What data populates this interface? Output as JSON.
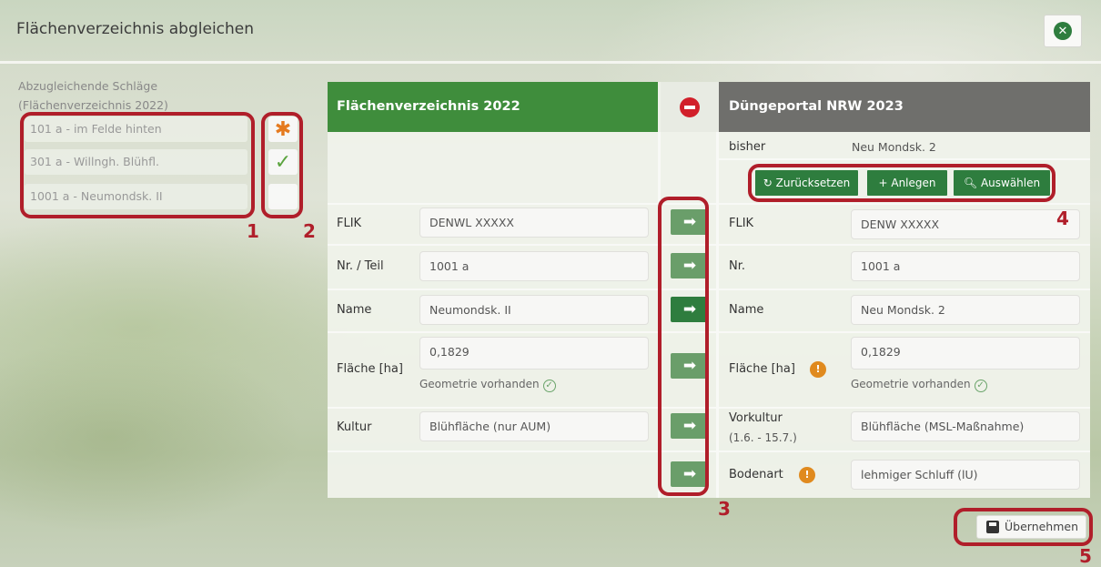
{
  "dialog": {
    "title": "Flächenverzeichnis abgleichen",
    "close_icon": "close-circle-icon"
  },
  "left_list": {
    "label_line1": "Abzugleichende Schläge",
    "label_line2": "(Flächenverzeichnis 2022)",
    "items": [
      {
        "label": "101 a - im Felde hinten",
        "status_icon": "asterisk-icon",
        "status_glyph": "✱"
      },
      {
        "label": "301 a - Willngh. Blühfl.",
        "status_icon": "check-icon",
        "status_glyph": "✓"
      },
      {
        "label": "1001 a - Neumondsk. II",
        "status_icon": "empty-icon",
        "status_glyph": ""
      }
    ]
  },
  "annotations": {
    "n1": "1",
    "n2": "2",
    "n3": "3",
    "n4": "4",
    "n5": "5"
  },
  "left_column": {
    "header": "Flächenverzeichnis 2022",
    "rows": {
      "flik_label": "FLIK",
      "flik_value": "DENWL  XXXXX",
      "nr_label": "Nr. / Teil",
      "nr_value": "1001 a",
      "name_label": "Name",
      "name_value": "Neumondsk. II",
      "flaeche_label": "Fläche [ha]",
      "flaeche_value": "0,1829",
      "geometry": "Geometrie vorhanden",
      "kultur_label": "Kultur",
      "kultur_value": "Blühfläche (nur AUM)"
    }
  },
  "right_column": {
    "header": "Düngeportal NRW 2023",
    "bisher_label": "bisher",
    "bisher_value": "Neu Mondsk. 2",
    "buttons": {
      "reset": "Zurücksetzen",
      "create": "Anlegen",
      "select": "Auswählen"
    },
    "rows": {
      "flik_label": "FLIK",
      "flik_value": "DENW  XXXXX",
      "nr_label": "Nr.",
      "nr_value": "1001 a",
      "name_label": "Name",
      "name_value": "Neu Mondsk. 2",
      "flaeche_label": "Fläche [ha]",
      "flaeche_value": "0,1829",
      "geometry": "Geometrie vorhanden",
      "vorkultur_label": "Vorkultur",
      "vorkultur_sub": "(1.6. - 15.7.)",
      "vorkultur_value": "Blühfläche (MSL-Maßnahme)",
      "bodenart_label": "Bodenart",
      "bodenart_value": "lehmiger Schluff (lU)"
    }
  },
  "footer": {
    "save_label": "Übernehmen"
  },
  "colors": {
    "green": "#3f8d3c",
    "dark_green": "#2e7d3e",
    "gray_header": "#6f6f6c",
    "red": "#d11f2a",
    "annotation_red": "#b01e2a",
    "info_orange": "#e08a1e"
  }
}
